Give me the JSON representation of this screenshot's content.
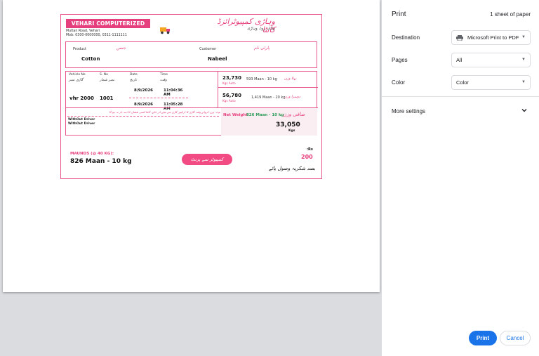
{
  "receipt": {
    "banner": "VEHARI COMPUTERIZED KANTA",
    "address": "Multan Road, Vehari",
    "mobile": "Mob: 0300-0000000, 0311-1111111",
    "urdu_title": "وہاڑی کمپیوٹرائزڈ کانٹا",
    "urdu_subtitle": "ملتان روڈ، وہاڑی",
    "truck_icon": "truck-icon",
    "product_label": "Product",
    "product_urdu": "جنس",
    "product_value": "Cotton",
    "customer_label": "Customer",
    "customer_urdu": "پارٹی نام",
    "customer_value": "Nabeel",
    "headers": {
      "vehicle_no": "Vehicle No",
      "vehicle_no_urdu": "گاڑی نمبر",
      "s_no": "S. No",
      "s_no_urdu": "نمبر شمار",
      "date": "Date",
      "date_urdu": "تاریخ",
      "time": "Time",
      "time_urdu": "وقت"
    },
    "vehicle_value": "vhr 2000",
    "serial_value": "1001",
    "first": {
      "date": "8/9/2026",
      "time": "11:04:36 AM",
      "weight": "23,730",
      "unit": "Kgs Auto",
      "maan": "593 Maan - 10 kg",
      "urdu": "پہلا وزن"
    },
    "second": {
      "date": "8/9/2026",
      "time": "11:05:28 AM",
      "weight": "56,780",
      "unit": "Kgs Auto",
      "maan": "1,419 Maan - 20 kg",
      "urdu": "دوسرا وزن"
    },
    "urdu_notice": "نوٹ: وزن کرواتے وقت گاڑی کا ڈرائیور گاڑی سے نیچے اتر جائے، کانٹا کسی نقصان کا ذمہ دار نہ ہو گا",
    "driver_1": "WithOut Driver",
    "driver_2": "WithOut Driver",
    "net_label": "Net Weight",
    "net_maan": "826 Maan - 10 kg",
    "net_urdu": "صافی وزن",
    "net_value": "33,050",
    "net_unit": "Kgs",
    "maunds_label": "MAUNDS (@ 40 KG):",
    "maunds_value": "826 Maan - 10 kg",
    "pill_text": "کمپیوٹر سے پرنٹ",
    "rs_label": ":Rs",
    "rs_value": "200",
    "thanks_urdu": "بصد شکریہ وصول پائے"
  },
  "panel": {
    "title": "Print",
    "sheet_count": "1 sheet of paper",
    "destination_label": "Destination",
    "destination_value": "Microsoft Print to PDF",
    "pages_label": "Pages",
    "pages_value": "All",
    "color_label": "Color",
    "color_value": "Color",
    "more_settings": "More settings",
    "print_button": "Print",
    "cancel_button": "Cancel"
  },
  "colors": {
    "accent_pink": "#e63f7d",
    "net_green": "#2e9c57",
    "print_blue": "#1a73e8"
  }
}
